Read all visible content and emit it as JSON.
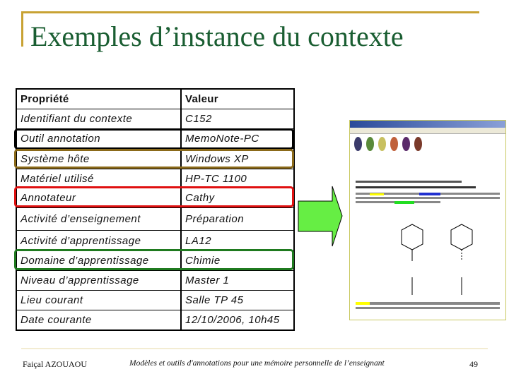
{
  "title": "Exemples d’instance du contexte",
  "table": {
    "headers": [
      "Propriété",
      "Valeur"
    ],
    "rows": [
      [
        "Identifiant du contexte",
        "C152"
      ],
      [
        "Outil annotation",
        "MemoNote-PC"
      ],
      [
        "Système hôte",
        "Windows XP"
      ],
      [
        "Matériel utilisé",
        "HP-TC 1100"
      ],
      [
        "Annotateur",
        "Cathy"
      ],
      [
        "Activité d’enseignement",
        "Préparation"
      ],
      [
        "Activité d’apprentissage",
        "LA12"
      ],
      [
        "Domaine d’apprentissage",
        "Chimie"
      ],
      [
        "Niveau d’apprentissage",
        "Master 1"
      ],
      [
        "Lieu courant",
        "Salle TP 45"
      ],
      [
        "Date courante",
        "12/10/2006, 10h45"
      ]
    ]
  },
  "highlight_colors": {
    "outil": "#000000",
    "systeme": "#8b6a1a",
    "annotateur": "#e01010",
    "domaine": "#1f7a1f"
  },
  "arrow_color": "#66ee44",
  "footer": {
    "author": "Faiçal AZOUAOU",
    "subtitle": "Modèles et outils d'annotations pour une mémoire personnelle de l’enseignant",
    "page": "49"
  }
}
